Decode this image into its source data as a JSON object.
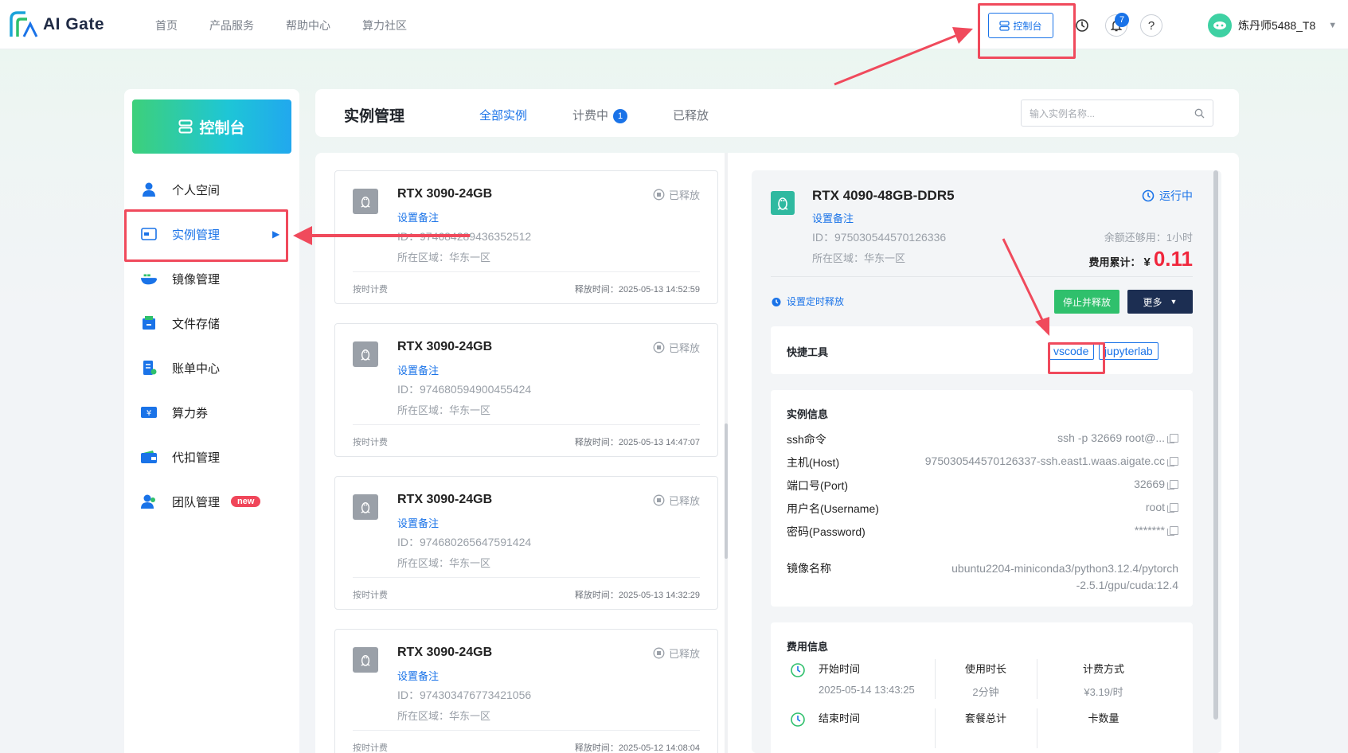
{
  "brand": {
    "name": "AI Gate"
  },
  "nav": [
    "首页",
    "产品服务",
    "帮助中心",
    "算力社区"
  ],
  "topbar": {
    "console": "控制台",
    "bell_count": "7",
    "help": "?",
    "username": "炼丹师5488_T8"
  },
  "sidebar": {
    "title": "控制台",
    "items": [
      {
        "label": "个人空间",
        "icon": "user-icon"
      },
      {
        "label": "实例管理",
        "icon": "instance-icon"
      },
      {
        "label": "镜像管理",
        "icon": "docker-icon"
      },
      {
        "label": "文件存储",
        "icon": "storage-icon"
      },
      {
        "label": "账单中心",
        "icon": "bill-icon"
      },
      {
        "label": "算力券",
        "icon": "coupon-icon"
      },
      {
        "label": "代扣管理",
        "icon": "wallet-icon"
      },
      {
        "label": "团队管理",
        "icon": "team-icon",
        "badge": "new"
      }
    ]
  },
  "page": {
    "title": "实例管理",
    "tabs": [
      "全部实例",
      "计费中",
      "已释放"
    ],
    "billing_count": "1",
    "search_placeholder": "输入实例名称..."
  },
  "instances": [
    {
      "name": "RTX 3090-24GB",
      "note": "设置备注",
      "id": "ID：974684289436352512",
      "region": "所在区域：华东一区",
      "status": "已释放",
      "billing": "按时计费",
      "release": "释放时间：2025-05-13 14:52:59"
    },
    {
      "name": "RTX 3090-24GB",
      "note": "设置备注",
      "id": "ID：974680594900455424",
      "region": "所在区域：华东一区",
      "status": "已释放",
      "billing": "按时计费",
      "release": "释放时间：2025-05-13 14:47:07"
    },
    {
      "name": "RTX 3090-24GB",
      "note": "设置备注",
      "id": "ID：974680265647591424",
      "region": "所在区域：华东一区",
      "status": "已释放",
      "billing": "按时计费",
      "release": "释放时间：2025-05-13 14:32:29"
    },
    {
      "name": "RTX 3090-24GB",
      "note": "设置备注",
      "id": "ID：974303476773421056",
      "region": "所在区域：华东一区",
      "status": "已释放",
      "billing": "按时计费",
      "release": "释放时间：2025-05-12 14:08:04"
    }
  ],
  "detail": {
    "name": "RTX 4090-48GB-DDR5",
    "note": "设置备注",
    "id": "ID：975030544570126336",
    "region": "所在区域：华东一区",
    "status": "运行中",
    "balance": "余额还够用：1小时",
    "fee_label": "费用累计：",
    "fee_currency": "¥",
    "fee_amount": "0.11",
    "timer": "设置定时释放",
    "stop_btn": "停止并释放",
    "more_btn": "更多",
    "quick_label": "快捷工具",
    "quick_tools": [
      "vscode",
      "jupyterlab"
    ],
    "info_title": "实例信息",
    "info": [
      {
        "k": "ssh命令",
        "v": "ssh -p 32669 root@..."
      },
      {
        "k": "主机(Host)",
        "v": "975030544570126337-ssh.east1.waas.aigate.cc"
      },
      {
        "k": "端口号(Port)",
        "v": "32669"
      },
      {
        "k": "用户名(Username)",
        "v": "root"
      },
      {
        "k": "密码(Password)",
        "v": "*******"
      }
    ],
    "image_label": "镜像名称",
    "image_line1": "ubuntu2204-miniconda3/python3.12.4/pytorch",
    "image_line2": "-2.5.1/gpu/cuda:12.4",
    "fee_title": "费用信息",
    "start_label": "开始时间",
    "start_value": "2025-05-14 13:43:25",
    "duration_label": "使用时长",
    "duration_value": "2分钟",
    "method_label": "计费方式",
    "method_value": "¥3.19/时",
    "end_label": "结束时间",
    "package_label": "套餐总计",
    "cards_label": "卡数量"
  }
}
